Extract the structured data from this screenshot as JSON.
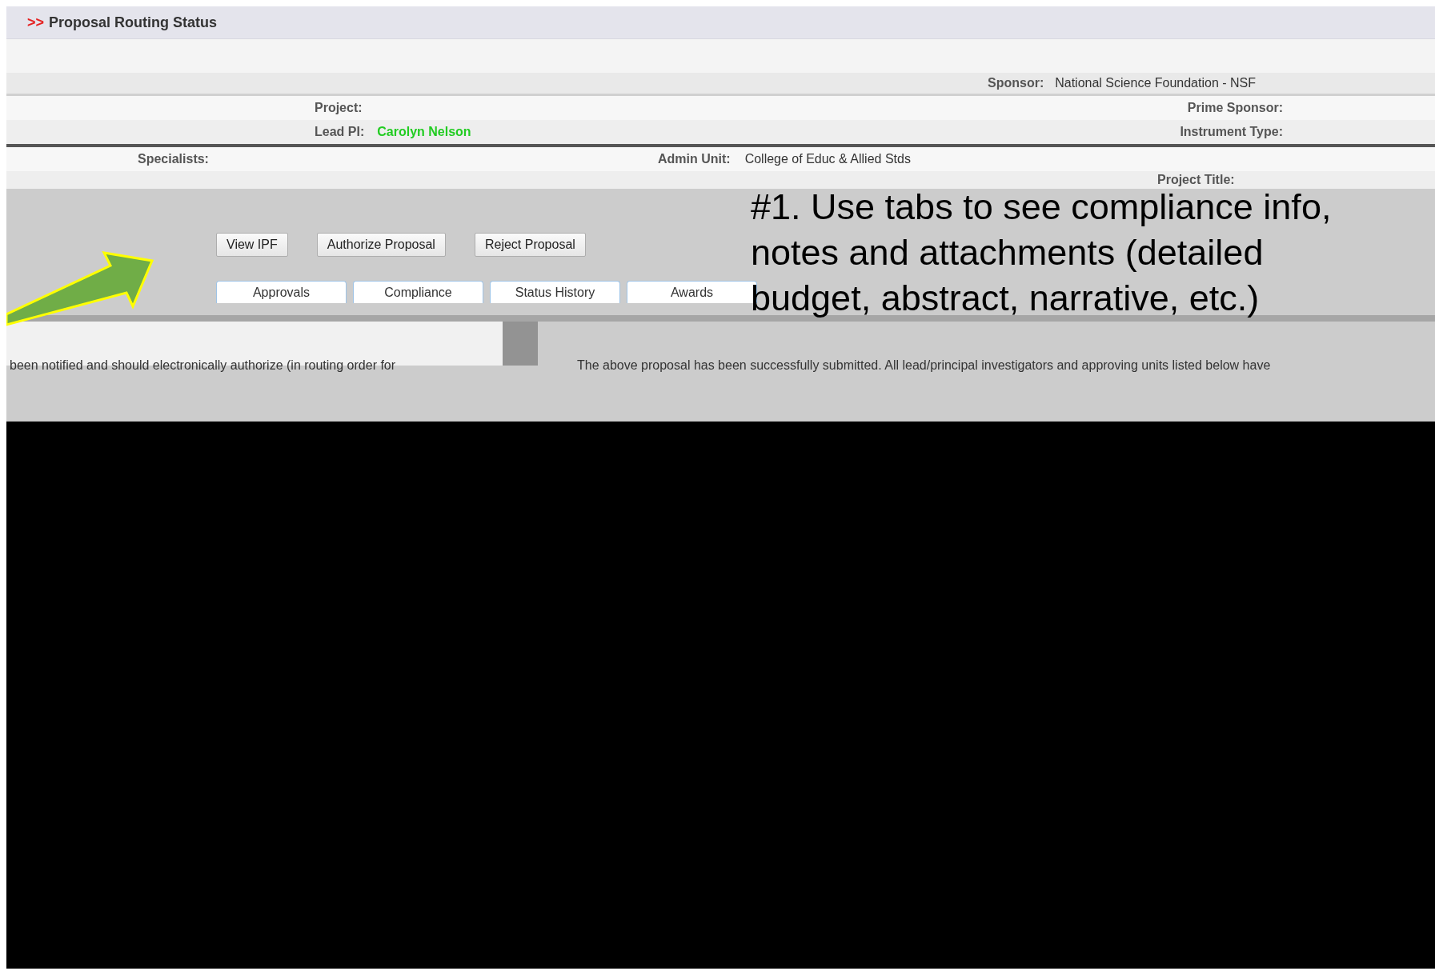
{
  "header": {
    "marker": ">>",
    "title": "Proposal Routing Status"
  },
  "sponsor_row": {
    "label": "Sponsor:",
    "value": "National Science Foundation - NSF"
  },
  "project_row": {
    "left": {
      "label": "Project:"
    },
    "right": {
      "label": "Prime Sponsor:"
    }
  },
  "lead_row": {
    "left": {
      "label": "Lead PI:",
      "value": "Carolyn Nelson"
    },
    "right": {
      "label": "Instrument Type:"
    }
  },
  "unit_row": {
    "left": {
      "label": "Specialists:"
    },
    "right": {
      "label": "Admin Unit:",
      "value": "College of Educ & Allied Stds"
    }
  },
  "title_row": {
    "label": "Project Title:"
  },
  "buttons": [
    "View IPF",
    "Authorize Proposal",
    "Reject Proposal"
  ],
  "tabs": [
    {
      "label": "Approvals",
      "selected": false
    },
    {
      "label": "Compliance",
      "selected": false
    },
    {
      "label": "Status History",
      "selected": false
    },
    {
      "label": "Awards",
      "selected": false
    }
  ],
  "callout": {
    "text": "#1. Use tabs to see compliance info, notes and attachments (detailed budget, abstract, narrative, etc.)"
  },
  "body_text": {
    "left": "been notified and should electronically authorize (in routing order for",
    "right": "The above proposal has been successfully submitted. All lead/principal investigators and approving units listed below have"
  }
}
